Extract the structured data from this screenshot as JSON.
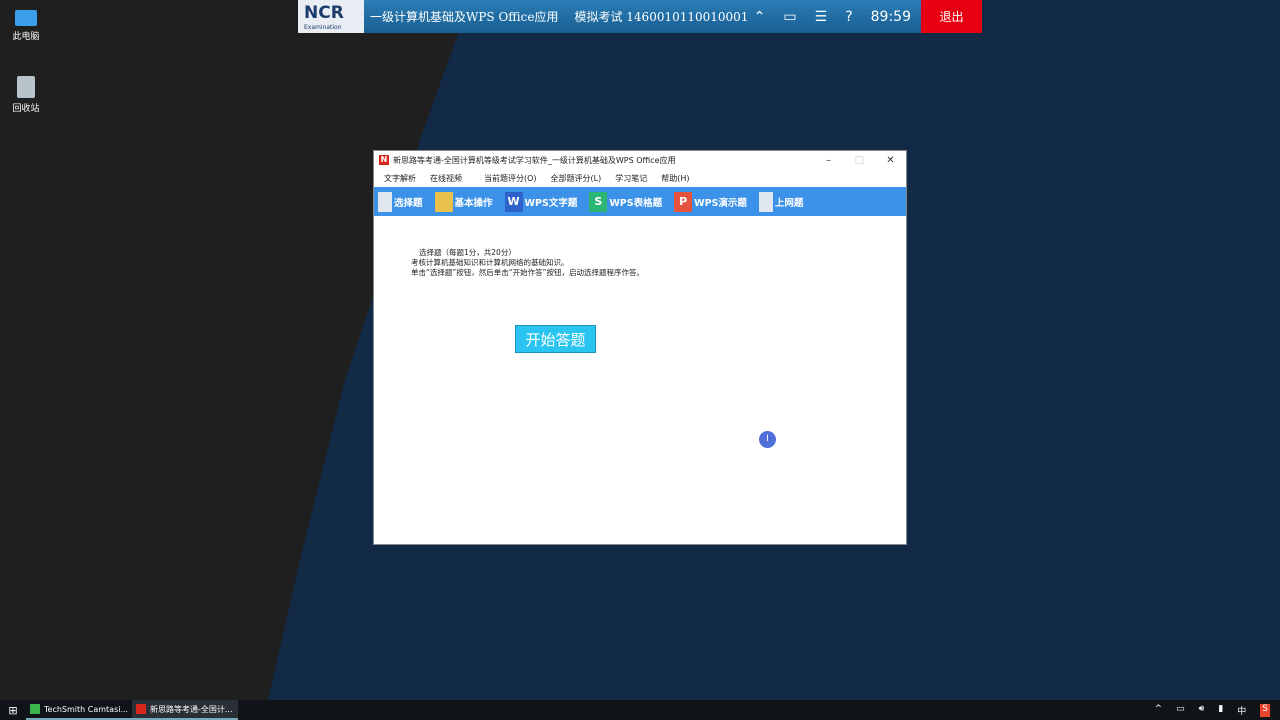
{
  "desktop": {
    "icons": [
      {
        "label": "此电脑"
      },
      {
        "label": "回收站"
      }
    ]
  },
  "exam_bar": {
    "logo": "NCR",
    "logo_sub": "Examination",
    "title": "一级计算机基础及WPS Office应用",
    "exam_label": "模拟考试 1460010110010001",
    "timer": "89:59",
    "quit": "退出",
    "help": "?"
  },
  "window": {
    "title": "新思路等考通-全国计算机等级考试学习软件_一级计算机基础及WPS Office应用",
    "menu": [
      "文字解析",
      "在线视频",
      "当前题评分(O)",
      "全部题评分(L)",
      "学习笔记",
      "帮助(H)"
    ],
    "toolbar": [
      {
        "label": "选择题",
        "icon": "doc-icon",
        "color": "#e0e6ee"
      },
      {
        "label": "基本操作",
        "icon": "folder-icon",
        "color": "#e8c04a"
      },
      {
        "label": "WPS文字题",
        "icon": "wps-writer-icon",
        "color": "#2d62c8"
      },
      {
        "label": "WPS表格题",
        "icon": "wps-sheet-icon",
        "color": "#2bb673"
      },
      {
        "label": "WPS演示题",
        "icon": "wps-present-icon",
        "color": "#e5533c"
      },
      {
        "label": "上网题",
        "icon": "doc-icon",
        "color": "#e0e6ee"
      }
    ],
    "content": {
      "line1": "选择题（每题1分，共20分）",
      "line2": "考核计算机基础知识和计算机网络的基础知识。",
      "line3": "单击“选择题”按钮，然后单击“开始作答”按钮，启动选择题程序作答。"
    },
    "start_button": "开始答题"
  },
  "taskbar": {
    "items": [
      "TechSmith Camtasi...",
      "新思路等考通-全国计..."
    ],
    "tray": [
      "^",
      "中",
      "S"
    ]
  }
}
